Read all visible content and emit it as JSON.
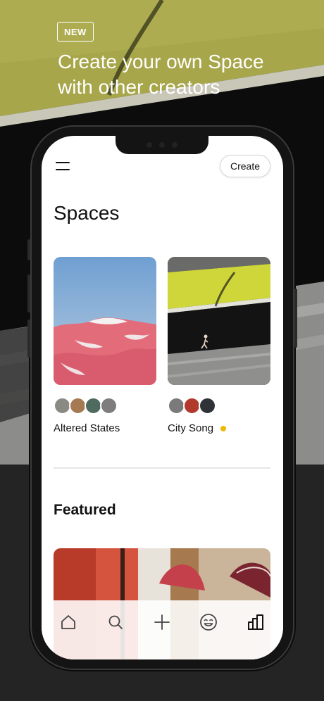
{
  "promo": {
    "badge": "NEW",
    "headline": "Create your own Space with other creators"
  },
  "app": {
    "create_label": "Create",
    "spaces_title": "Spaces",
    "featured_title": "Featured",
    "spaces": [
      {
        "name": "Altered States",
        "has_new": false,
        "avatar_colors": [
          "#8a8a85",
          "#a57a52",
          "#4f6a5e",
          "#7d7d7d"
        ]
      },
      {
        "name": "City Song",
        "has_new": true,
        "avatar_colors": [
          "#7a7a7a",
          "#b13a2c",
          "#2f3338"
        ]
      }
    ],
    "tabs": [
      "home-icon",
      "search-icon",
      "plus-icon",
      "smiley-icon",
      "stats-icon"
    ]
  },
  "colors": {
    "new_indicator": "#f2b705",
    "olive_band": "#a7a64b",
    "background": "#242424"
  }
}
